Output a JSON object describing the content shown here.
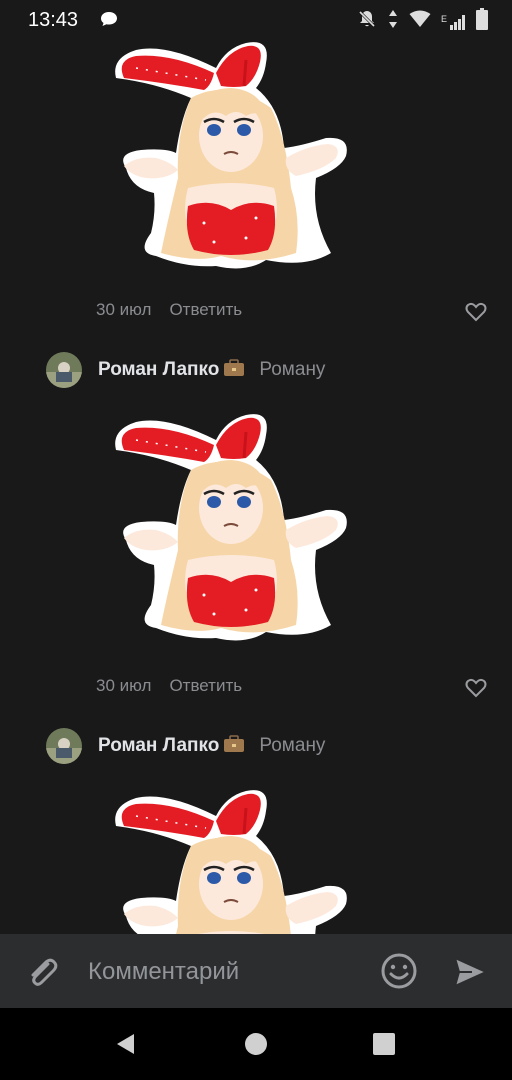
{
  "status_bar": {
    "time": "13:43",
    "network": "E",
    "icons": [
      "message-icon",
      "bell-off-icon",
      "data-arrows-icon",
      "wifi-icon",
      "signal-icon",
      "battery-icon"
    ]
  },
  "comments": [
    {
      "date": "30 июл",
      "reply_label": "Ответить"
    },
    {
      "author": "Роман Лапко",
      "to": "Роману",
      "date": "30 июл",
      "reply_label": "Ответить"
    },
    {
      "author": "Роман Лапко",
      "to": "Роману"
    }
  ],
  "composer": {
    "placeholder": "Комментарий"
  },
  "colors": {
    "background": "#19191a",
    "composer_bg": "#2c2d2e",
    "sticker_red": "#e41d25",
    "muted_text": "#8a8c90"
  }
}
